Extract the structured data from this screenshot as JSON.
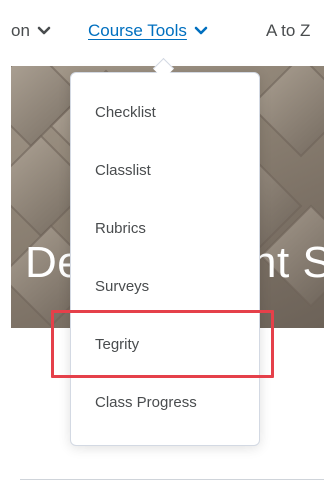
{
  "topnav": {
    "prev_label": "on",
    "course_tools_label": "Course Tools",
    "atoz_label": "A to Z"
  },
  "banner": {
    "title": "Development S"
  },
  "dropdown": {
    "items": [
      {
        "label": "Checklist"
      },
      {
        "label": "Classlist"
      },
      {
        "label": "Rubrics"
      },
      {
        "label": "Surveys"
      },
      {
        "label": "Tegrity"
      },
      {
        "label": "Class Progress"
      }
    ]
  },
  "colors": {
    "link": "#006fbf",
    "text": "#494c4e",
    "highlight": "#e5404a"
  }
}
